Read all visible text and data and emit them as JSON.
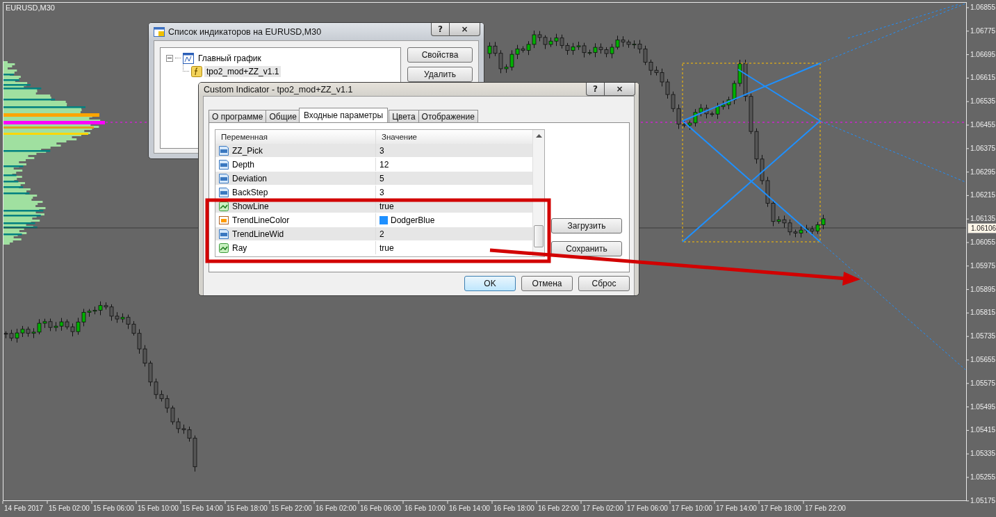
{
  "chart": {
    "symbol_label": "EURUSD,M30",
    "price_axis": [
      "1.06855",
      "1.06775",
      "1.06695",
      "1.06615",
      "1.06535",
      "1.06455",
      "1.06375",
      "1.06295",
      "1.06215",
      "1.06135",
      "1.06055",
      "1.05975",
      "1.05895",
      "1.05815",
      "1.05735",
      "1.05655",
      "1.05575",
      "1.05495",
      "1.05415",
      "1.05335",
      "1.05255",
      "1.05175"
    ],
    "current_price": "1.06106",
    "time_axis": [
      "14 Feb 2017",
      "15 Feb 02:00",
      "15 Feb 06:00",
      "15 Feb 10:00",
      "15 Feb 14:00",
      "15 Feb 18:00",
      "15 Feb 22:00",
      "16 Feb 02:00",
      "16 Feb 06:00",
      "16 Feb 10:00",
      "16 Feb 14:00",
      "16 Feb 18:00",
      "16 Feb 22:00",
      "17 Feb 02:00",
      "17 Feb 06:00",
      "17 Feb 10:00",
      "17 Feb 14:00",
      "17 Feb 18:00",
      "17 Feb 22:00"
    ]
  },
  "indicator_list_dialog": {
    "title": "Список индикаторов на EURUSD,M30",
    "title_buttons": [
      "?",
      "×"
    ],
    "tree": [
      {
        "label": "Главный график",
        "expanded": true,
        "children": [
          {
            "label": "tpo2_mod+ZZ_v1.1",
            "selected": true
          }
        ]
      }
    ],
    "buttons": [
      "Свойства",
      "Удалить"
    ]
  },
  "indicator_dialog": {
    "title": "Custom Indicator - tpo2_mod+ZZ_v1.1",
    "title_buttons": [
      "?",
      "×"
    ],
    "tabs": [
      {
        "label": "О программе",
        "selected": false
      },
      {
        "label": "Общие",
        "selected": false
      },
      {
        "label": "Входные параметры",
        "selected": true
      },
      {
        "label": "Цвета",
        "selected": false
      },
      {
        "label": "Отображение",
        "selected": false
      }
    ],
    "table": {
      "columns": [
        "Переменная",
        "Значение"
      ],
      "rows": [
        {
          "kind": "int",
          "name": "ZZ_Pick",
          "value": "3"
        },
        {
          "kind": "int",
          "name": "Depth",
          "value": "12"
        },
        {
          "kind": "int",
          "name": "Deviation",
          "value": "5"
        },
        {
          "kind": "int",
          "name": "BackStep",
          "value": "3"
        },
        {
          "kind": "bool",
          "name": "ShowLine",
          "value": "true"
        },
        {
          "kind": "color",
          "name": "TrendLineColor",
          "value": "DodgerBlue",
          "color": "#1e90ff"
        },
        {
          "kind": "int",
          "name": "TrendLineWid",
          "value": "2"
        },
        {
          "kind": "bool",
          "name": "Ray",
          "value": "true"
        }
      ]
    },
    "side_buttons": [
      "Загрузить",
      "Сохранить"
    ],
    "buttons": [
      "OK",
      "Отмена",
      "Сброс"
    ]
  }
}
